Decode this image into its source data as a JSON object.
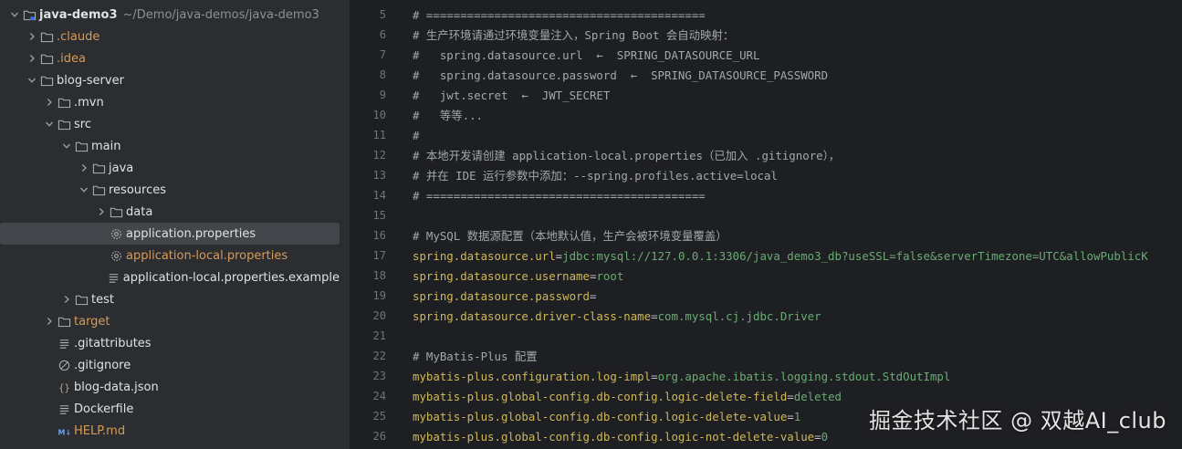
{
  "project": {
    "name": "java-demo3",
    "path": "~/Demo/java-demos/java-demo3"
  },
  "tree": [
    {
      "label": "java-demo3",
      "path": "~/Demo/java-demos/java-demo3",
      "type": "module-folder",
      "depth": 0,
      "expanded": true,
      "bold": true
    },
    {
      "label": ".claude",
      "type": "folder",
      "depth": 1,
      "expanded": false,
      "color": "orange"
    },
    {
      "label": ".idea",
      "type": "folder",
      "depth": 1,
      "expanded": false,
      "color": "orange"
    },
    {
      "label": "blog-server",
      "type": "folder",
      "depth": 1,
      "expanded": true
    },
    {
      "label": ".mvn",
      "type": "folder",
      "depth": 2,
      "expanded": false
    },
    {
      "label": "src",
      "type": "folder",
      "depth": 2,
      "expanded": true
    },
    {
      "label": "main",
      "type": "folder",
      "depth": 3,
      "expanded": true
    },
    {
      "label": "java",
      "type": "folder",
      "depth": 4,
      "expanded": false
    },
    {
      "label": "resources",
      "type": "folder",
      "depth": 4,
      "expanded": true
    },
    {
      "label": "data",
      "type": "folder",
      "depth": 5,
      "expanded": false
    },
    {
      "label": "application.properties",
      "type": "properties",
      "depth": 5,
      "selected": true
    },
    {
      "label": "application-local.properties",
      "type": "properties",
      "depth": 5,
      "color": "orange"
    },
    {
      "label": "application-local.properties.example",
      "type": "text",
      "depth": 5
    },
    {
      "label": "test",
      "type": "folder",
      "depth": 3,
      "expanded": false
    },
    {
      "label": "target",
      "type": "folder",
      "depth": 2,
      "expanded": false,
      "color": "orange"
    },
    {
      "label": ".gitattributes",
      "type": "text",
      "depth": 2
    },
    {
      "label": ".gitignore",
      "type": "ignore",
      "depth": 2
    },
    {
      "label": "blog-data.json",
      "type": "json",
      "depth": 2
    },
    {
      "label": "Dockerfile",
      "type": "text",
      "depth": 2
    },
    {
      "label": "HELP.md",
      "type": "markdown",
      "depth": 2,
      "color": "orange"
    }
  ],
  "editor": {
    "lines": [
      {
        "num": "5",
        "kind": "comment",
        "text": "# ========================================="
      },
      {
        "num": "6",
        "kind": "comment",
        "text": "# 生产环境请通过环境变量注入，Spring Boot 会自动映射："
      },
      {
        "num": "7",
        "kind": "comment",
        "text": "#   spring.datasource.url  ←  SPRING_DATASOURCE_URL"
      },
      {
        "num": "8",
        "kind": "comment",
        "text": "#   spring.datasource.password  ←  SPRING_DATASOURCE_PASSWORD"
      },
      {
        "num": "9",
        "kind": "comment",
        "text": "#   jwt.secret  ←  JWT_SECRET"
      },
      {
        "num": "10",
        "kind": "comment",
        "text": "#   等等..."
      },
      {
        "num": "11",
        "kind": "comment",
        "text": "#"
      },
      {
        "num": "12",
        "kind": "comment",
        "text": "# 本地开发请创建 application-local.properties（已加入 .gitignore），"
      },
      {
        "num": "13",
        "kind": "comment",
        "text": "# 并在 IDE 运行参数中添加：--spring.profiles.active=local"
      },
      {
        "num": "14",
        "kind": "comment",
        "text": "# ========================================="
      },
      {
        "num": "15",
        "kind": "blank",
        "text": ""
      },
      {
        "num": "16",
        "kind": "comment",
        "text": "# MySQL 数据源配置（本地默认值，生产会被环境变量覆盖）"
      },
      {
        "num": "17",
        "kind": "prop",
        "key": "spring.datasource.url",
        "value": "jdbc:mysql://127.0.0.1:3306/java_demo3_db?useSSL=false&serverTimezone=UTC&allowPublicK"
      },
      {
        "num": "18",
        "kind": "prop",
        "key": "spring.datasource.username",
        "value": "root"
      },
      {
        "num": "19",
        "kind": "prop",
        "key": "spring.datasource.password",
        "value": ""
      },
      {
        "num": "20",
        "kind": "prop",
        "key": "spring.datasource.driver-class-name",
        "value": "com.mysql.cj.jdbc.Driver"
      },
      {
        "num": "21",
        "kind": "blank",
        "text": ""
      },
      {
        "num": "22",
        "kind": "comment",
        "text": "# MyBatis-Plus 配置"
      },
      {
        "num": "23",
        "kind": "prop",
        "key": "mybatis-plus.configuration.log-impl",
        "value": "org.apache.ibatis.logging.stdout.StdOutImpl"
      },
      {
        "num": "24",
        "kind": "prop",
        "key": "mybatis-plus.global-config.db-config.logic-delete-field",
        "value": "deleted"
      },
      {
        "num": "25",
        "kind": "prop",
        "key": "mybatis-plus.global-config.db-config.logic-delete-value",
        "value": "1"
      },
      {
        "num": "26",
        "kind": "prop",
        "key": "mybatis-plus.global-config.db-config.logic-not-delete-value",
        "value": "0"
      }
    ]
  },
  "watermark": "掘金技术社区 @ 双越AI_club",
  "colors": {
    "tree_bg": "#2b2d30",
    "editor_bg": "#1e1f22",
    "selection": "#43454a",
    "comment": "#a4a7ad",
    "key": "#cfb85a",
    "value": "#6aab73",
    "orange_file": "#d69a5c",
    "folder_icon": "#afb1b3"
  }
}
